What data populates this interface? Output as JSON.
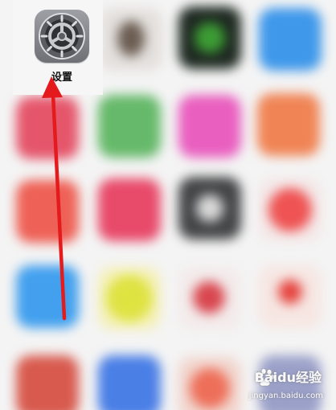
{
  "settings_app": {
    "label": "设置",
    "icon": "gear-icon",
    "colors": {
      "tile": "#8a8c92",
      "gear": "#3e4046"
    }
  },
  "annotation": {
    "type": "arrow",
    "color": "#e41a1c"
  },
  "watermark": {
    "brand": "Baidu经验",
    "url": "jingyan.baidu.com"
  },
  "blurred_app_colors": [
    "#6b5d52",
    "#2f8a2c",
    "#3f98ea",
    "#e5566b",
    "#66b96a",
    "#e95fbf",
    "#f08455",
    "#ee6156",
    "#e84a6a",
    "#444547",
    "#ef5353",
    "#42a0ee",
    "#dfe342",
    "#d9474f",
    "#e6433e",
    "#d85a4e",
    "#4a7fe6",
    "#ee6f59",
    "#9aa0c8"
  ]
}
